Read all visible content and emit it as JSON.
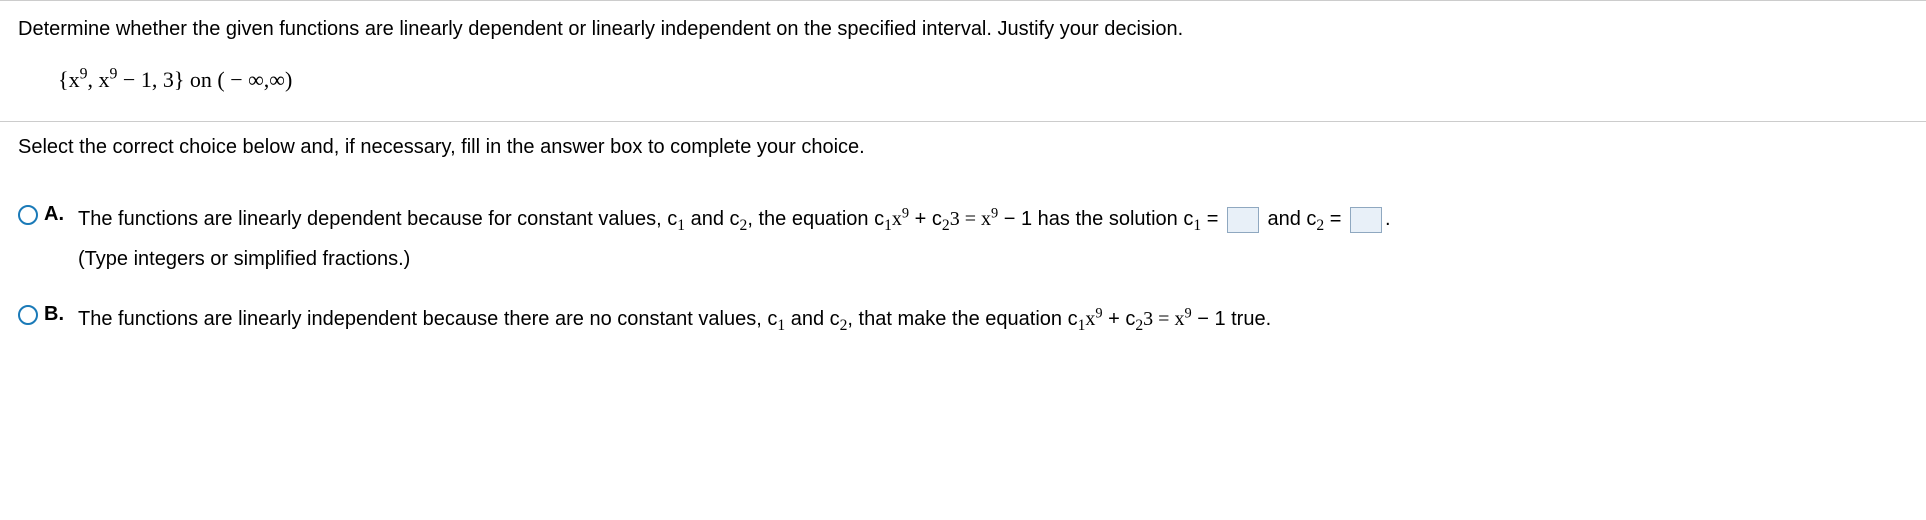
{
  "question": {
    "text": "Determine whether the given functions are linearly dependent or linearly independent on the specified interval. Justify your decision.",
    "math_set_open": "{",
    "math_f1_base": "x",
    "math_f1_exp": "9",
    "math_comma1": ", ",
    "math_f2_base": "x",
    "math_f2_exp": "9",
    "math_f2_rest": " − 1, 3",
    "math_set_close": "}",
    "math_on": " on ( − ∞,∞)"
  },
  "instruction": "Select the correct choice below and, if necessary, fill in the answer box to complete your choice.",
  "choices": {
    "a": {
      "label": "A.",
      "pre": "The functions are linearly dependent because for constant values, c",
      "sub1": "1",
      "mid1": " and c",
      "sub2": "2",
      "mid2": ", the equation c",
      "sub3": "1",
      "x1": "x",
      "exp1": "9",
      "plus": " + c",
      "sub4": "2",
      "three": "3 = x",
      "exp2": "9",
      "minus1": " − 1 has the solution c",
      "sub5": "1",
      "eq1": " = ",
      "andc2": " and c",
      "sub6": "2",
      "eq2": " = ",
      "period": ".",
      "hint": "(Type integers or simplified fractions.)"
    },
    "b": {
      "label": "B.",
      "pre": "The functions are linearly independent because there are no constant values, c",
      "sub1": "1",
      "mid1": " and c",
      "sub2": "2",
      "mid2": ", that make the equation c",
      "sub3": "1",
      "x1": "x",
      "exp1": "9",
      "plus": " + c",
      "sub4": "2",
      "three": "3 = x",
      "exp2": "9",
      "minus1": " − 1 true."
    }
  }
}
